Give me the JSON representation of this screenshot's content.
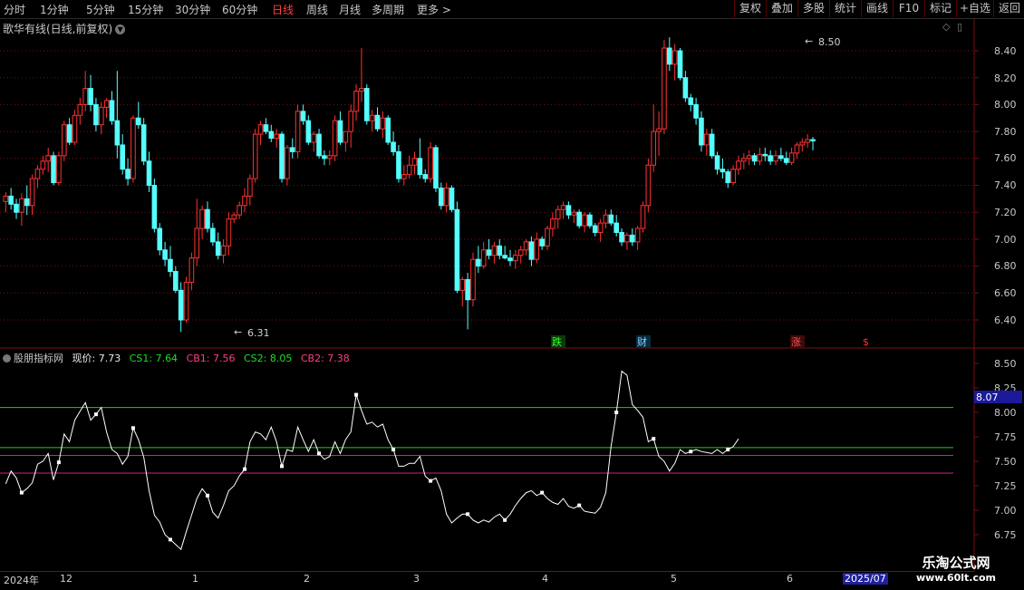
{
  "toolbar": {
    "timeframes": [
      "分时",
      "1分钟",
      "5分钟",
      "15分钟",
      "30分钟",
      "60分钟",
      "日线",
      "周线",
      "月线",
      "多周期",
      "更多 >"
    ],
    "active": "日线",
    "right_buttons": [
      "复权",
      "叠加",
      "多股",
      "统计",
      "画线",
      "F10",
      "标记",
      "+自选",
      "返回"
    ]
  },
  "price_panel": {
    "title": "歌华有线(日线,前复权)",
    "yticks": [
      "8.40",
      "8.20",
      "8.00",
      "7.80",
      "7.60",
      "7.40",
      "7.20",
      "7.00",
      "6.80",
      "6.60",
      "6.40"
    ],
    "high_marker": "8.50",
    "low_marker": "6.31",
    "event_markers": [
      "跌",
      "财",
      "涨",
      "$"
    ]
  },
  "indicator_panel": {
    "name": "股朋指标网",
    "now_label": "现价: 7.73",
    "cs1_label": "CS1: 7.64",
    "cb1_label": "CB1: 7.56",
    "cs2_label": "CS2: 8.05",
    "cb2_label": "CB2: 7.38",
    "yticks": [
      "8.50",
      "8.25",
      "8.00",
      "7.75",
      "7.50",
      "7.25",
      "7.00",
      "6.75"
    ],
    "current_value_tag": "8.07"
  },
  "date_axis": {
    "labels": [
      "2024年",
      "12",
      "1",
      "2",
      "3",
      "4",
      "5",
      "6",
      "2025/07"
    ]
  },
  "watermark": {
    "line1": "乐淘公式网",
    "line2": "www.60lt.com"
  },
  "colors": {
    "up": "#ff3232",
    "down": "#54ffff",
    "bg": "#000000",
    "cs_line": "#22cc22",
    "cb_line": "#cc2288",
    "grid": "#7a1010"
  },
  "chart_data": [
    {
      "type": "candlestick",
      "title": "歌华有线(日线,前复权)",
      "ylim": [
        6.28,
        8.55
      ],
      "candles": [
        [
          7.28,
          7.35,
          7.2,
          7.32
        ],
        [
          7.32,
          7.38,
          7.22,
          7.26
        ],
        [
          7.26,
          7.3,
          7.15,
          7.2
        ],
        [
          7.2,
          7.34,
          7.1,
          7.3
        ],
        [
          7.3,
          7.4,
          7.18,
          7.25
        ],
        [
          7.25,
          7.48,
          7.18,
          7.45
        ],
        [
          7.45,
          7.55,
          7.38,
          7.52
        ],
        [
          7.52,
          7.62,
          7.48,
          7.58
        ],
        [
          7.58,
          7.68,
          7.5,
          7.62
        ],
        [
          7.62,
          7.65,
          7.4,
          7.42
        ],
        [
          7.42,
          7.65,
          7.4,
          7.62
        ],
        [
          7.62,
          7.88,
          7.58,
          7.85
        ],
        [
          7.85,
          7.9,
          7.7,
          7.72
        ],
        [
          7.72,
          7.96,
          7.7,
          7.92
        ],
        [
          7.92,
          8.05,
          7.85,
          8.0
        ],
        [
          8.0,
          8.25,
          7.95,
          8.12
        ],
        [
          8.12,
          8.22,
          7.95,
          8.0
        ],
        [
          8.0,
          8.05,
          7.8,
          7.85
        ],
        [
          7.85,
          8.02,
          7.78,
          7.98
        ],
        [
          7.98,
          8.05,
          7.9,
          8.03
        ],
        [
          8.03,
          8.1,
          7.85,
          7.88
        ],
        [
          7.88,
          8.25,
          7.6,
          7.7
        ],
        [
          7.7,
          7.78,
          7.48,
          7.52
        ],
        [
          7.52,
          7.6,
          7.4,
          7.45
        ],
        [
          7.45,
          7.92,
          7.42,
          7.9
        ],
        [
          7.9,
          8.02,
          7.82,
          7.85
        ],
        [
          7.85,
          7.9,
          7.55,
          7.58
        ],
        [
          7.58,
          7.65,
          7.35,
          7.4
        ],
        [
          7.4,
          7.45,
          7.05,
          7.08
        ],
        [
          7.08,
          7.12,
          6.88,
          6.92
        ],
        [
          6.92,
          6.98,
          6.8,
          6.85
        ],
        [
          6.85,
          6.95,
          6.72,
          6.76
        ],
        [
          6.76,
          6.8,
          6.6,
          6.62
        ],
        [
          6.62,
          6.68,
          6.31,
          6.4
        ],
        [
          6.4,
          6.72,
          6.38,
          6.68
        ],
        [
          6.68,
          6.9,
          6.62,
          6.86
        ],
        [
          6.86,
          7.3,
          6.8,
          7.08
        ],
        [
          7.08,
          7.25,
          7.0,
          7.22
        ],
        [
          7.22,
          7.28,
          7.05,
          7.08
        ],
        [
          7.08,
          7.12,
          6.95,
          6.98
        ],
        [
          6.98,
          7.05,
          6.85,
          6.88
        ],
        [
          6.88,
          7.0,
          6.82,
          6.95
        ],
        [
          6.95,
          7.2,
          6.88,
          7.15
        ],
        [
          7.15,
          7.2,
          7.12,
          7.18
        ],
        [
          7.18,
          7.28,
          7.15,
          7.25
        ],
        [
          7.25,
          7.38,
          7.2,
          7.32
        ],
        [
          7.32,
          7.48,
          7.25,
          7.45
        ],
        [
          7.45,
          7.82,
          7.42,
          7.78
        ],
        [
          7.78,
          7.88,
          7.7,
          7.85
        ],
        [
          7.85,
          7.9,
          7.78,
          7.8
        ],
        [
          7.8,
          7.85,
          7.72,
          7.75
        ],
        [
          7.75,
          7.82,
          7.68,
          7.78
        ],
        [
          7.78,
          7.8,
          7.42,
          7.45
        ],
        [
          7.45,
          7.7,
          7.4,
          7.68
        ],
        [
          7.68,
          7.75,
          7.6,
          7.65
        ],
        [
          7.65,
          8.0,
          7.6,
          7.95
        ],
        [
          7.95,
          8.0,
          7.85,
          7.88
        ],
        [
          7.88,
          7.92,
          7.7,
          7.72
        ],
        [
          7.72,
          7.8,
          7.65,
          7.78
        ],
        [
          7.78,
          7.82,
          7.6,
          7.62
        ],
        [
          7.62,
          7.66,
          7.55,
          7.6
        ],
        [
          7.6,
          7.66,
          7.55,
          7.62
        ],
        [
          7.62,
          7.92,
          7.58,
          7.88
        ],
        [
          7.88,
          7.95,
          7.7,
          7.72
        ],
        [
          7.72,
          7.8,
          7.65,
          7.8
        ],
        [
          7.8,
          8.0,
          7.68,
          7.95
        ],
        [
          7.95,
          8.15,
          7.88,
          8.1
        ],
        [
          8.1,
          8.42,
          8.02,
          8.12
        ],
        [
          8.12,
          8.15,
          7.85,
          7.88
        ],
        [
          7.88,
          7.96,
          7.8,
          7.92
        ],
        [
          7.92,
          7.98,
          7.8,
          7.82
        ],
        [
          7.82,
          7.95,
          7.75,
          7.9
        ],
        [
          7.9,
          7.92,
          7.7,
          7.72
        ],
        [
          7.72,
          7.8,
          7.62,
          7.65
        ],
        [
          7.65,
          7.7,
          7.42,
          7.45
        ],
        [
          7.45,
          7.55,
          7.4,
          7.48
        ],
        [
          7.48,
          7.62,
          7.45,
          7.55
        ],
        [
          7.55,
          7.65,
          7.48,
          7.6
        ],
        [
          7.6,
          7.75,
          7.45,
          7.48
        ],
        [
          7.48,
          7.52,
          7.42,
          7.45
        ],
        [
          7.45,
          7.72,
          7.42,
          7.68
        ],
        [
          7.68,
          7.7,
          7.35,
          7.38
        ],
        [
          7.38,
          7.42,
          7.22,
          7.25
        ],
        [
          7.25,
          7.42,
          7.2,
          7.38
        ],
        [
          7.38,
          7.4,
          7.2,
          7.22
        ],
        [
          7.22,
          7.28,
          6.6,
          6.62
        ],
        [
          6.62,
          6.72,
          6.5,
          6.7
        ],
        [
          6.7,
          6.75,
          6.33,
          6.55
        ],
        [
          6.55,
          6.9,
          6.5,
          6.85
        ],
        [
          6.85,
          6.95,
          6.75,
          6.8
        ],
        [
          6.8,
          6.98,
          6.78,
          6.92
        ],
        [
          6.92,
          7.0,
          6.85,
          6.88
        ],
        [
          6.88,
          6.98,
          6.82,
          6.95
        ],
        [
          6.95,
          7.0,
          6.85,
          6.88
        ],
        [
          6.88,
          6.95,
          6.85,
          6.86
        ],
        [
          6.86,
          6.92,
          6.8,
          6.84
        ],
        [
          6.84,
          6.92,
          6.78,
          6.88
        ],
        [
          6.88,
          6.95,
          6.82,
          6.92
        ],
        [
          6.92,
          7.0,
          6.88,
          6.98
        ],
        [
          6.98,
          7.02,
          6.8,
          6.85
        ],
        [
          6.85,
          7.05,
          6.82,
          7.0
        ],
        [
          7.0,
          7.02,
          6.92,
          6.95
        ],
        [
          6.95,
          7.1,
          6.92,
          7.08
        ],
        [
          7.08,
          7.2,
          7.02,
          7.15
        ],
        [
          7.15,
          7.25,
          7.08,
          7.22
        ],
        [
          7.22,
          7.28,
          7.15,
          7.25
        ],
        [
          7.25,
          7.28,
          7.15,
          7.18
        ],
        [
          7.18,
          7.22,
          7.12,
          7.2
        ],
        [
          7.2,
          7.22,
          7.08,
          7.1
        ],
        [
          7.1,
          7.2,
          7.05,
          7.18
        ],
        [
          7.18,
          7.2,
          7.08,
          7.1
        ],
        [
          7.1,
          7.12,
          7.02,
          7.05
        ],
        [
          7.05,
          7.15,
          6.98,
          7.12
        ],
        [
          7.12,
          7.22,
          7.08,
          7.18
        ],
        [
          7.18,
          7.22,
          7.1,
          7.12
        ],
        [
          7.12,
          7.18,
          7.02,
          7.05
        ],
        [
          7.05,
          7.08,
          6.95,
          6.98
        ],
        [
          6.98,
          7.05,
          6.92,
          7.03
        ],
        [
          7.03,
          7.08,
          6.95,
          6.98
        ],
        [
          6.98,
          7.1,
          6.92,
          7.08
        ],
        [
          7.08,
          7.28,
          7.05,
          7.25
        ],
        [
          7.25,
          7.6,
          7.2,
          7.55
        ],
        [
          7.55,
          8.0,
          7.5,
          7.8
        ],
        [
          7.8,
          7.95,
          7.62,
          7.82
        ],
        [
          7.82,
          8.48,
          7.78,
          8.42
        ],
        [
          8.42,
          8.5,
          8.25,
          8.3
        ],
        [
          8.3,
          8.45,
          8.18,
          8.4
        ],
        [
          8.4,
          8.42,
          8.18,
          8.2
        ],
        [
          8.2,
          8.25,
          8.02,
          8.05
        ],
        [
          8.05,
          8.08,
          7.95,
          8.0
        ],
        [
          8.0,
          8.05,
          7.85,
          7.9
        ],
        [
          7.9,
          7.95,
          7.65,
          7.7
        ],
        [
          7.7,
          7.82,
          7.62,
          7.78
        ],
        [
          7.78,
          7.82,
          7.6,
          7.62
        ],
        [
          7.62,
          7.65,
          7.48,
          7.52
        ],
        [
          7.52,
          7.6,
          7.45,
          7.5
        ],
        [
          7.5,
          7.52,
          7.38,
          7.42
        ],
        [
          7.42,
          7.55,
          7.4,
          7.52
        ],
        [
          7.52,
          7.62,
          7.48,
          7.58
        ],
        [
          7.58,
          7.64,
          7.52,
          7.6
        ],
        [
          7.6,
          7.66,
          7.55,
          7.62
        ],
        [
          7.62,
          7.64,
          7.55,
          7.58
        ],
        [
          7.58,
          7.68,
          7.55,
          7.63
        ],
        [
          7.63,
          7.68,
          7.58,
          7.62
        ],
        [
          7.62,
          7.66,
          7.55,
          7.58
        ],
        [
          7.58,
          7.66,
          7.55,
          7.62
        ],
        [
          7.62,
          7.68,
          7.58,
          7.6
        ],
        [
          7.6,
          7.65,
          7.55,
          7.57
        ],
        [
          7.57,
          7.68,
          7.55,
          7.64
        ],
        [
          7.64,
          7.72,
          7.6,
          7.7
        ],
        [
          7.7,
          7.75,
          7.65,
          7.72
        ],
        [
          7.72,
          7.78,
          7.68,
          7.74
        ],
        [
          7.74,
          7.76,
          7.66,
          7.73
        ]
      ]
    },
    {
      "type": "line",
      "title": "股朋指标网",
      "ylim": [
        6.72,
        8.58
      ],
      "series": [
        {
          "name": "现价",
          "values": [
            7.27,
            7.4,
            7.33,
            7.18,
            7.22,
            7.28,
            7.47,
            7.5,
            7.58,
            7.31,
            7.49,
            7.78,
            7.7,
            7.92,
            8.01,
            8.1,
            7.92,
            7.98,
            8.05,
            7.8,
            7.62,
            7.58,
            7.47,
            7.55,
            7.84,
            7.72,
            7.54,
            7.2,
            6.95,
            6.88,
            6.75,
            6.7,
            6.65,
            6.6,
            6.78,
            6.95,
            7.12,
            7.22,
            7.15,
            6.98,
            6.92,
            7.05,
            7.2,
            7.25,
            7.35,
            7.42,
            7.7,
            7.8,
            7.78,
            7.72,
            7.85,
            7.7,
            7.45,
            7.62,
            7.6,
            7.85,
            7.72,
            7.6,
            7.72,
            7.58,
            7.52,
            7.55,
            7.7,
            7.58,
            7.72,
            7.8,
            8.18,
            8.02,
            7.88,
            7.9,
            7.85,
            7.88,
            7.72,
            7.62,
            7.45,
            7.45,
            7.48,
            7.48,
            7.55,
            7.35,
            7.3,
            7.33,
            7.2,
            6.96,
            6.87,
            6.92,
            6.96,
            6.96,
            6.9,
            6.87,
            6.9,
            6.88,
            6.93,
            6.96,
            6.9,
            6.96,
            7.05,
            7.12,
            7.18,
            7.2,
            7.15,
            7.18,
            7.12,
            7.08,
            7.06,
            7.12,
            7.04,
            7.02,
            7.05,
            6.99,
            6.98,
            6.97,
            7.03,
            7.18,
            7.65,
            8.0,
            8.42,
            8.38,
            8.08,
            8.02,
            7.95,
            7.7,
            7.73,
            7.55,
            7.5,
            7.4,
            7.48,
            7.62,
            7.58,
            7.6,
            7.62,
            7.6,
            7.59,
            7.58,
            7.62,
            7.58,
            7.62,
            7.65,
            7.73
          ]
        }
      ],
      "levels": {
        "CS1": 7.64,
        "CB1": 7.56,
        "CS2": 8.05,
        "CB2": 7.38
      }
    }
  ]
}
